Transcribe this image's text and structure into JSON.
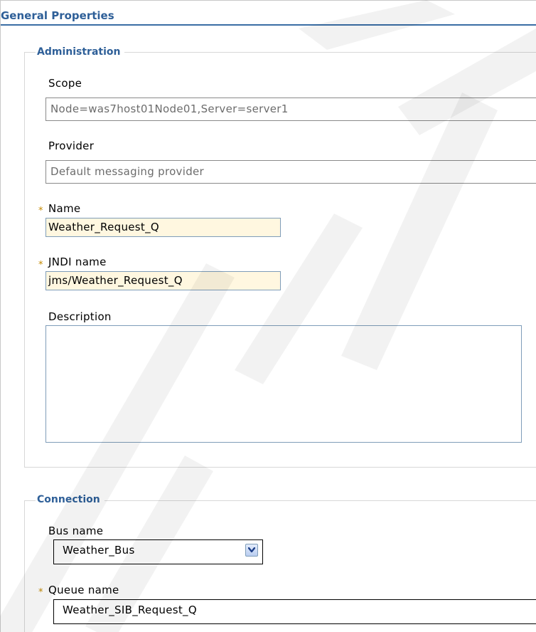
{
  "section": {
    "title": "General Properties"
  },
  "administration": {
    "legend": "Administration",
    "scope_label": "Scope",
    "scope_value": "Node=was7host01Node01,Server=server1",
    "provider_label": "Provider",
    "provider_value": "Default messaging provider",
    "name_label": "Name",
    "name_value": "Weather_Request_Q",
    "jndi_label": "JNDI name",
    "jndi_value": "jms/Weather_Request_Q",
    "description_label": "Description",
    "description_value": ""
  },
  "connection": {
    "legend": "Connection",
    "bus_label": "Bus name",
    "bus_value": "Weather_Bus",
    "queue_label": "Queue name",
    "queue_value": "Weather_SIB_Request_Q"
  },
  "required_marker": "*",
  "colors": {
    "accent": "#2e5f98",
    "required_field_bg": "#fff7e0",
    "required_marker": "#c48a00"
  },
  "icons": {
    "dropdown": "chevron-down-icon",
    "required": "asterisk-icon"
  }
}
